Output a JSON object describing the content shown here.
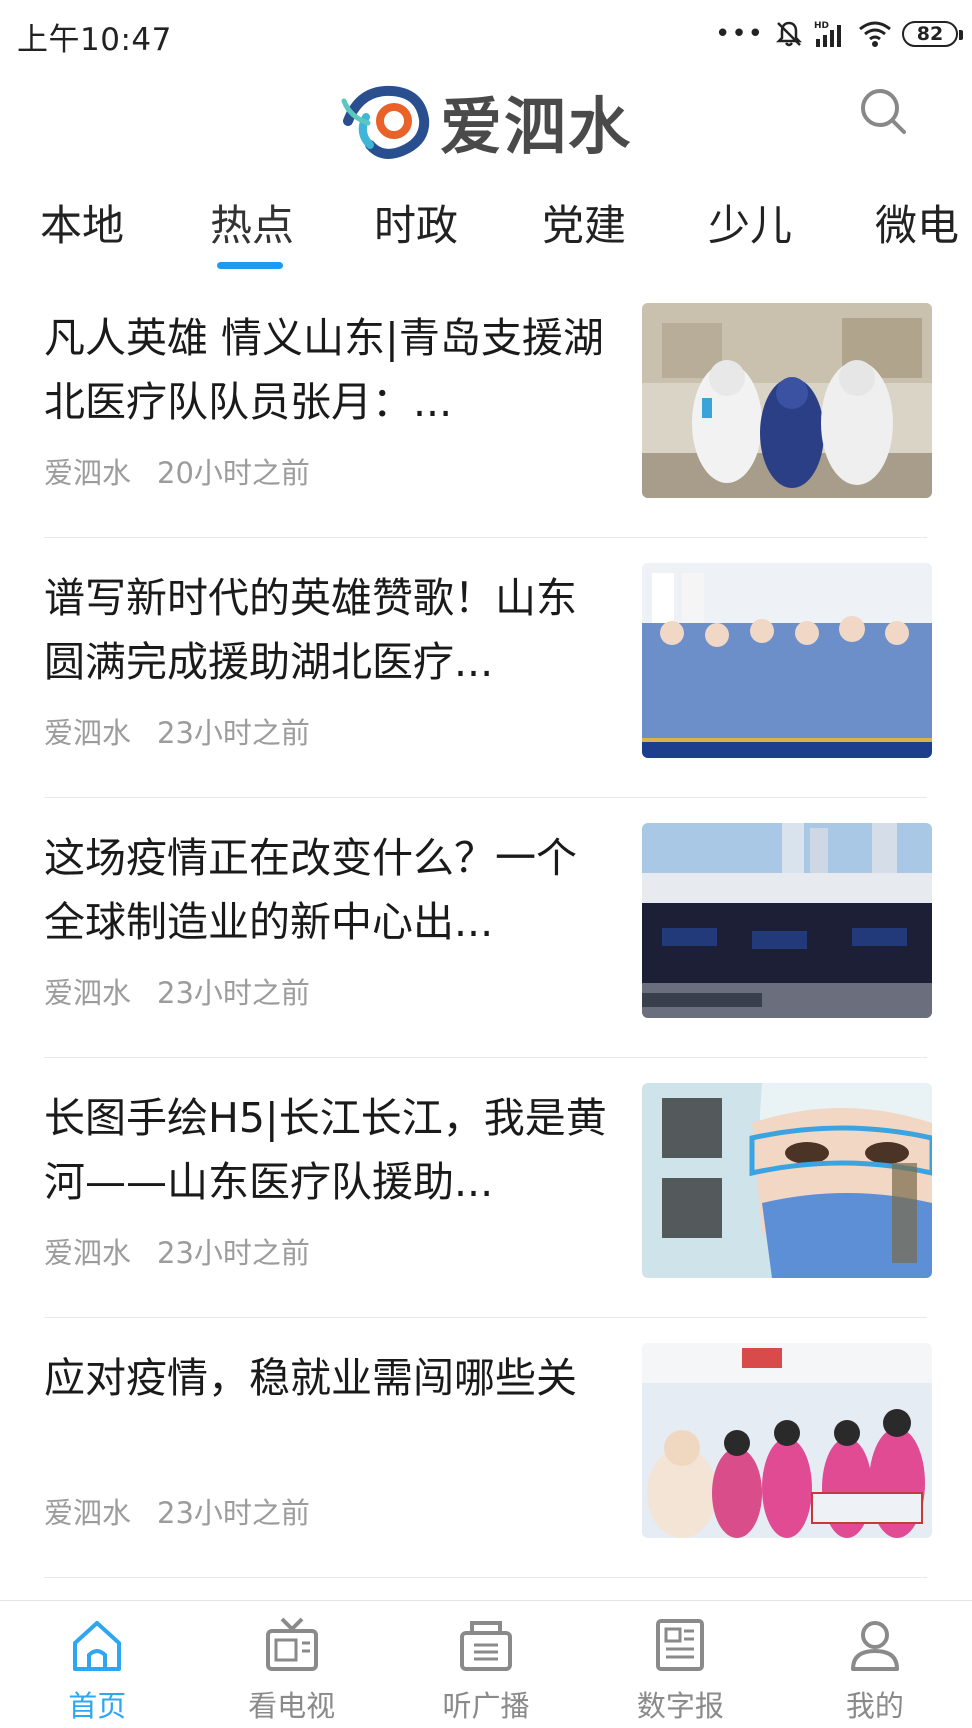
{
  "status": {
    "time": "上午10:47",
    "dots": "•••",
    "battery": "82"
  },
  "header": {
    "app_name": "爱泗水",
    "search_icon": "search-icon",
    "brand_color": "#1e9bf0"
  },
  "tabs": [
    {
      "label": "本地"
    },
    {
      "label": "热点",
      "active": true
    },
    {
      "label": "时政"
    },
    {
      "label": "党建"
    },
    {
      "label": "少儿"
    },
    {
      "label": "微电"
    }
  ],
  "news": [
    {
      "title": "凡人英雄 情义山东|青岛支援湖北医疗队队员张月：...",
      "source": "爱泗水",
      "time": "20小时之前"
    },
    {
      "title": "谱写新时代的英雄赞歌！山东圆满完成援助湖北医疗...",
      "source": "爱泗水",
      "time": "23小时之前"
    },
    {
      "title": "这场疫情正在改变什么？一个全球制造业的新中心出...",
      "source": "爱泗水",
      "time": "23小时之前"
    },
    {
      "title": "长图手绘H5|长江长江，我是黄河——山东医疗队援助...",
      "source": "爱泗水",
      "time": "23小时之前"
    },
    {
      "title": "应对疫情，稳就业需闯哪些关",
      "source": "爱泗水",
      "time": "23小时之前"
    }
  ],
  "nav": [
    {
      "label": "首页",
      "icon": "home-icon",
      "active": true
    },
    {
      "label": "看电视",
      "icon": "tv-icon"
    },
    {
      "label": "听广播",
      "icon": "radio-icon"
    },
    {
      "label": "数字报",
      "icon": "newspaper-icon"
    },
    {
      "label": "我的",
      "icon": "user-icon"
    }
  ]
}
